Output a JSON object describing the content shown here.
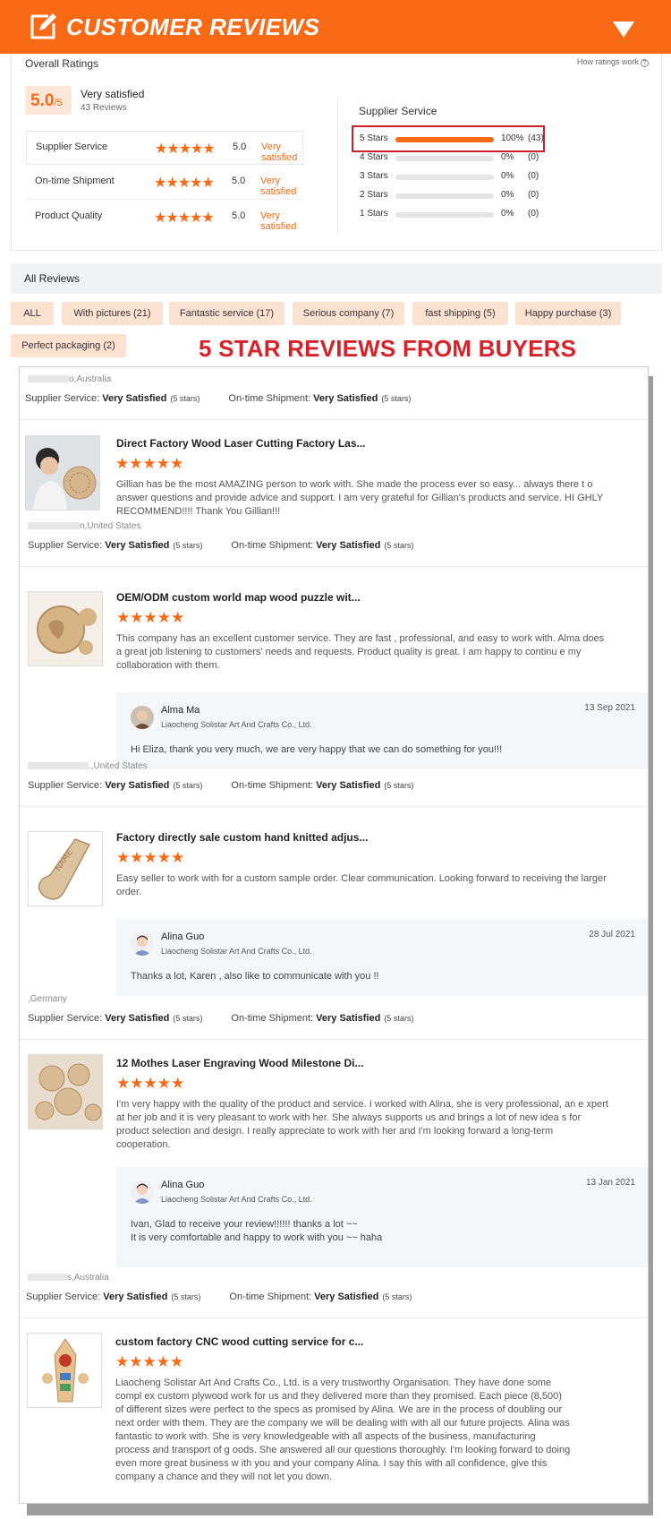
{
  "header": {
    "title": "CUSTOMER REVIEWS"
  },
  "overall": {
    "label": "Overall Ratings",
    "how_link": "How ratings work",
    "score": "5.0",
    "score_max": "/5",
    "satisfaction": "Very satisfied",
    "review_count": "43 Reviews",
    "rows": [
      {
        "label": "Supplier Service",
        "stars": "★★★★★",
        "value": "5.0",
        "text": "Very satisfied"
      },
      {
        "label": "On-time Shipment",
        "stars": "★★★★★",
        "value": "5.0",
        "text": "Very satisfied"
      },
      {
        "label": "Product Quality",
        "stars": "★★★★★",
        "value": "5.0",
        "text": "Very satisfied"
      }
    ]
  },
  "supplier_service": {
    "title": "Supplier Service",
    "rows": [
      {
        "label": "5 Stars",
        "fill": 1.0,
        "pct": "100%",
        "count": "(43)"
      },
      {
        "label": "4 Stars",
        "fill": 0,
        "pct": "0%",
        "count": "(0)"
      },
      {
        "label": "3 Stars",
        "fill": 0,
        "pct": "0%",
        "count": "(0)"
      },
      {
        "label": "2 Stars",
        "fill": 0,
        "pct": "0%",
        "count": "(0)"
      },
      {
        "label": "1 Stars",
        "fill": 0,
        "pct": "0%",
        "count": "(0)"
      }
    ]
  },
  "all_reviews": {
    "title": "All Reviews",
    "filters": [
      "ALL",
      "With pictures (21)",
      "Fantastic service (17)",
      "Serious company (7)",
      "fast shipping (5)",
      "Happy purchase (3)",
      "Perfect packaging (2)"
    ]
  },
  "banner": "5 STAR REVIEWS FROM BUYERS",
  "metric_labels": {
    "supplier": "Supplier Service:",
    "shipment": "On-time Shipment:",
    "value": "Very Satisfied",
    "stars": "(5 stars)"
  },
  "reviews": [
    {
      "location": "o,Australia",
      "title": "Direct Factory Wood Laser Cutting Factory Las...",
      "stars": "★★★★★",
      "text": "Gillian has be the most AMAZING person to work with. She made the process ever so easy... always there t o answer questions and provide advice and support. I am very grateful for Gillian's products and service. HI GHLY RECOMMEND!!!! Thank You Gillian!!!"
    },
    {
      "location": "n,United States",
      "title": "OEM/ODM custom world map wood puzzle wit...",
      "stars": "★★★★★",
      "text": "This company has an excellent customer service. They are fast , professional, and easy to work with. Alma does a great job listening to customers' needs and requests. Product quality is great. I am happy to continu e my collaboration with them.",
      "reply": {
        "name": "Alma Ma",
        "company": "Liaocheng Solistar Art And Crafts Co., Ltd.",
        "date": "13 Sep 2021",
        "text": "Hi Eliza, thank you very much, we are very happy that we can do something for you!!!"
      }
    },
    {
      "location": ".,United States",
      "title": "Factory directly sale custom hand knitted adjus...",
      "stars": "★★★★★",
      "text": "Easy seller to work with for a custom sample order. Clear communication. Looking forward to receiving the larger order.",
      "reply": {
        "name": "Alina Guo",
        "company": "Liaocheng Solistar Art And Crafts Co., Ltd.",
        "date": "28 Jul 2021",
        "text": "Thanks a lot,  Karen  , also like to communicate with you  !!"
      }
    },
    {
      "location": ",Germany",
      "title": "12 Mothes Laser Engraving Wood Milestone Di...",
      "stars": "★★★★★",
      "text": "I'm very happy with the quality of the product and service. I worked with Alina, she is very professional, an e xpert at her job and it is very pleasant to work with her. She always supports us and brings a lot of new idea s for product selection and design. I really appreciate to work with her and I'm looking forward a long-term cooperation.",
      "reply": {
        "name": "Alina Guo",
        "company": "Liaocheng Solistar Art And Crafts Co., Ltd.",
        "date": "13 Jan 2021",
        "text": "Ivan, Glad to receive your review!!!!!!  thanks a lot ~~\nIt is very comfortable and happy to work with you ~~ haha"
      }
    },
    {
      "location": "s,Australia",
      "title": "custom factory CNC wood cutting service for c...",
      "stars": "★★★★★",
      "text": "Liaocheng Solistar Art And Crafts Co., Ltd. is a very trustworthy Organisation. They have done some compl ex custom plywood work for us and they delivered more than they promised. Each piece (8,500) of different sizes were perfect to the specs as promised by Alina. We are in the process of doubling our next order with them. They are the company we will be dealing with with all our future projects. Alina was fantastic to work with. She is very knowledgeable with all aspects of the business, manufacturing process and transport of g oods. She answered all our  questions thoroughly. I'm looking forward to doing even more great business w ith you and your company Alina. I say this with all confidence, give this company a chance and they will not let you down."
    }
  ]
}
